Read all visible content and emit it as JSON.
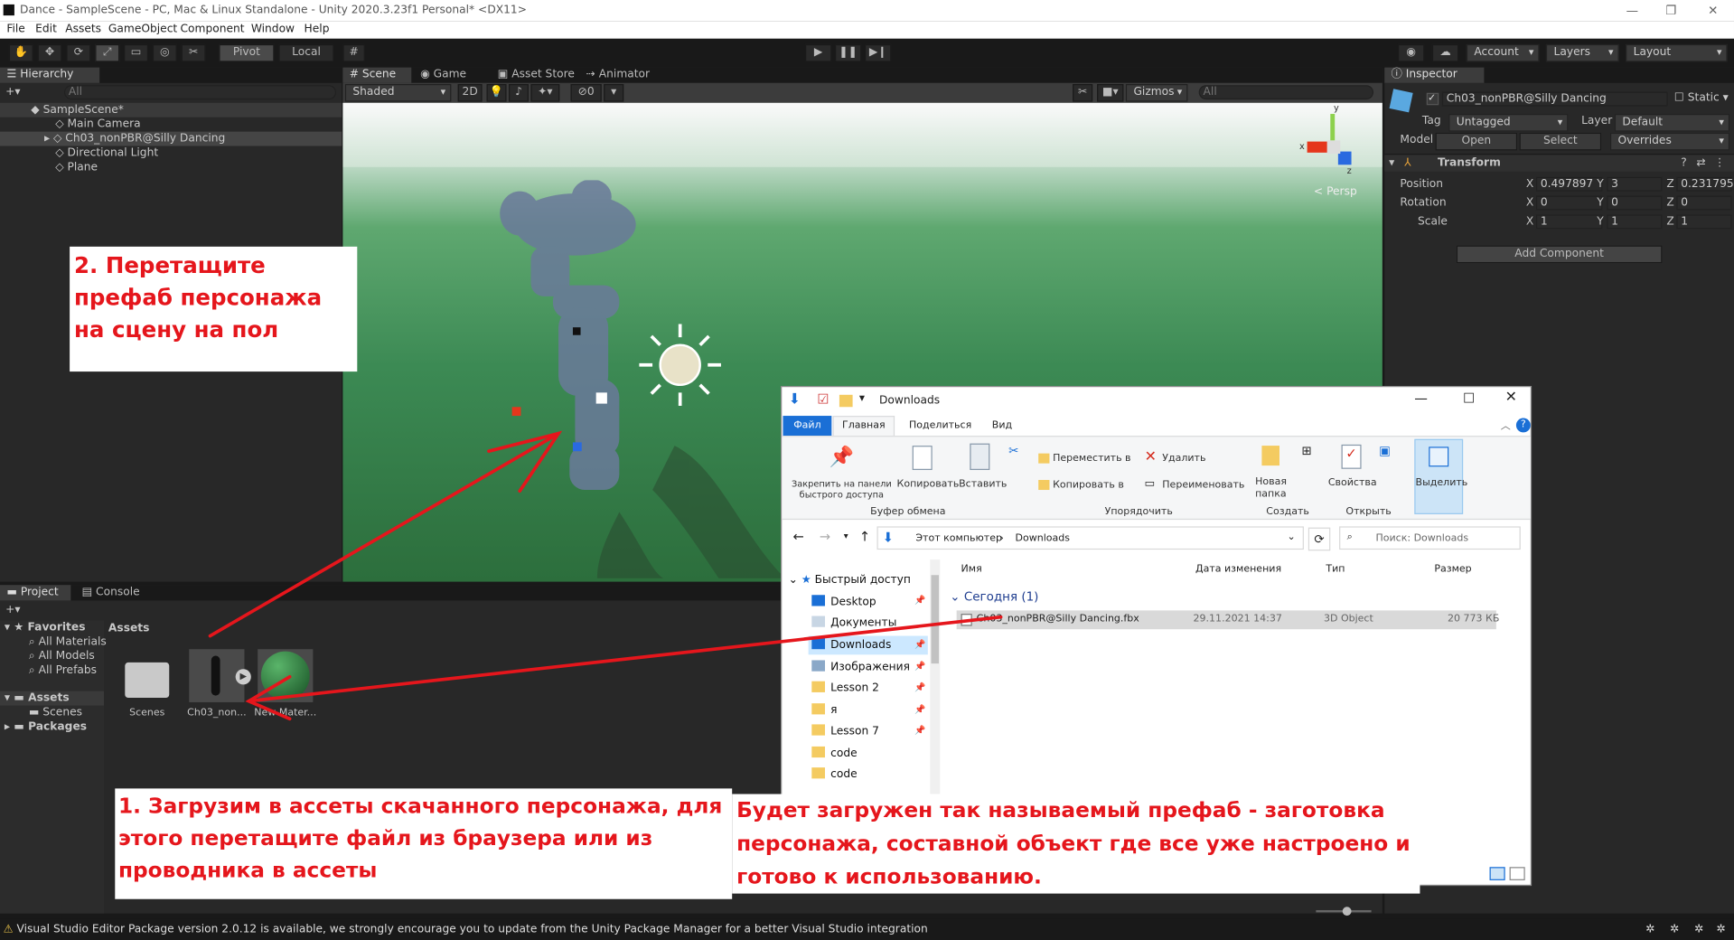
{
  "window": {
    "title": "Dance - SampleScene - PC, Mac & Linux Standalone - Unity 2020.3.23f1 Personal* <DX11>"
  },
  "menu": [
    "File",
    "Edit",
    "Assets",
    "GameObject",
    "Component",
    "Window",
    "Help"
  ],
  "toolbar": {
    "pivot": "Pivot",
    "local": "Local",
    "account": "Account",
    "layers": "Layers",
    "layout": "Layout"
  },
  "hierarchy": {
    "tab": "Hierarchy",
    "search_placeholder": "All",
    "scene": "SampleScene*",
    "items": [
      "Main Camera",
      "Ch03_nonPBR@Silly Dancing",
      "Directional Light",
      "Plane"
    ]
  },
  "scene": {
    "tabs": [
      "Scene",
      "Game",
      "Asset Store",
      "Animator"
    ],
    "shading": "Shaded",
    "mode2d": "2D",
    "gizmos": "Gizmos",
    "search_placeholder": "All",
    "persp": "Persp",
    "hidden_count": "0",
    "axis_x": "x",
    "axis_y": "y",
    "axis_z": "z"
  },
  "inspector": {
    "tab": "Inspector",
    "object_name": "Ch03_nonPBR@Silly Dancing",
    "static": "Static",
    "tag_label": "Tag",
    "tag_value": "Untagged",
    "layer_label": "Layer",
    "layer_value": "Default",
    "model_label": "Model",
    "open": "Open",
    "select": "Select",
    "overrides": "Overrides",
    "transform": "Transform",
    "position": {
      "label": "Position",
      "x": "0.497897",
      "y": "3",
      "z": "0.231795"
    },
    "rotation": {
      "label": "Rotation",
      "x": "0",
      "y": "0",
      "z": "0"
    },
    "scale": {
      "label": "Scale",
      "x": "1",
      "y": "1",
      "z": "1"
    },
    "add_component": "Add Component"
  },
  "project": {
    "tabs": [
      "Project",
      "Console"
    ],
    "favorites_label": "Favorites",
    "favorites": [
      "All Materials",
      "All Models",
      "All Prefabs"
    ],
    "assets_label": "Assets",
    "assets_children": [
      "Scenes"
    ],
    "packages_label": "Packages",
    "breadcrumb": "Assets",
    "items": [
      "Scenes",
      "Ch03_non...",
      "New Mater..."
    ]
  },
  "status": {
    "message": "Visual Studio Editor Package version 2.0.12 is available, we strongly encourage you to update from the Unity Package Manager for a better Visual Studio integration"
  },
  "annotations": {
    "a1": "1. Загрузим в ассеты скачанного персонажа, для этого перетащите файл из браузера или из проводника в ассеты",
    "a2": "2. Перетащите префаб персонажа на сцену на пол",
    "a3": "Будет загружен так называемый префаб - заготовка персонажа, составной объект где все уже настроено и готово к использованию."
  },
  "explorer": {
    "title": "Downloads",
    "ribbon_tabs": [
      "Файл",
      "Главная",
      "Поделиться",
      "Вид"
    ],
    "clipboard": {
      "pin": "Закрепить на панели быстрого доступа",
      "copy": "Копировать",
      "paste": "Вставить",
      "group": "Буфер обмена"
    },
    "organize": {
      "move": "Переместить в",
      "copyto": "Копировать в",
      "delete": "Удалить",
      "rename": "Переименовать",
      "group": "Упорядочить"
    },
    "create": {
      "newfolder": "Новая папка",
      "group": "Создать"
    },
    "open": {
      "props": "Свойства",
      "group": "Открыть"
    },
    "select": "Выделить",
    "path": [
      "Этот компьютер",
      "Downloads"
    ],
    "search_placeholder": "Поиск: Downloads",
    "columns": [
      "Имя",
      "Дата изменения",
      "Тип",
      "Размер"
    ],
    "group_header": "Сегодня (1)",
    "file": {
      "name": "Ch03_nonPBR@Silly Dancing.fbx",
      "date": "29.11.2021 14:37",
      "type": "3D Object",
      "size": "20 773 КБ"
    },
    "nav_quick": "Быстрый доступ",
    "nav": [
      "Desktop",
      "Документы",
      "Downloads",
      "Изображения",
      "Lesson 2",
      "я",
      "Lesson 7",
      "code",
      "code"
    ]
  },
  "colors": {
    "arrow": "#e5161c",
    "unity_bg": "#191919",
    "panel": "#282828",
    "scene_green": "#3f8d58"
  }
}
